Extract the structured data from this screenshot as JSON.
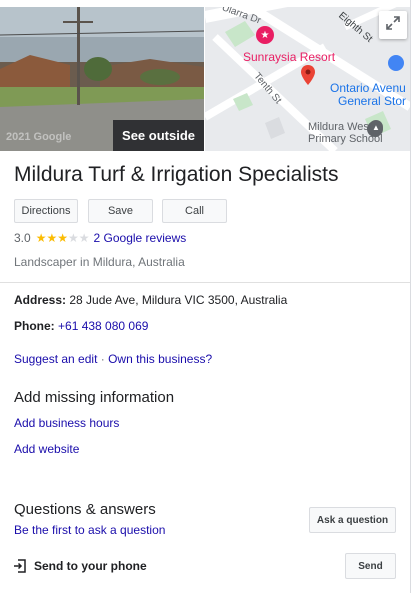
{
  "header": {
    "photo_button": "See outside",
    "photo_watermark": "2021 Google",
    "map_labels": {
      "street_ularra": "Ularra Dr",
      "street_eighth": "Eighth St",
      "street_tenth": "Tenth St",
      "poi_resort": "Sunraysia Resort",
      "poi_ontario_line1": "Ontario Avenu",
      "poi_ontario_line2": "General Stor",
      "poi_school_line1": "Mildura West",
      "poi_school_line2": "Primary School"
    },
    "expand_icon": "expand-icon"
  },
  "business": {
    "name": "Mildura Turf & Irrigation Specialists",
    "actions": {
      "directions": "Directions",
      "save": "Save",
      "call": "Call"
    },
    "rating": "3.0",
    "rating_value": 3,
    "rating_max": 5,
    "reviews_link": "2 Google reviews",
    "category": "Landscaper in Mildura, Australia"
  },
  "details": {
    "address_label": "Address:",
    "address_value": "28 Jude Ave, Mildura VIC 3500, Australia",
    "phone_label": "Phone:",
    "phone_value": "+61 438 080 069",
    "suggest_edit": "Suggest an edit",
    "separator": "·",
    "own_business": "Own this business?"
  },
  "missing_info": {
    "title": "Add missing information",
    "add_hours": "Add business hours",
    "add_website": "Add website"
  },
  "qa": {
    "title": "Questions & answers",
    "first_to_ask": "Be the first to ask a question",
    "ask_button": "Ask a question"
  },
  "send": {
    "label": "Send to your phone",
    "button": "Send"
  },
  "colors": {
    "link": "#1a0dab",
    "star": "#fbbc04",
    "pin": "#ea4335",
    "resort": "#e91e63"
  }
}
